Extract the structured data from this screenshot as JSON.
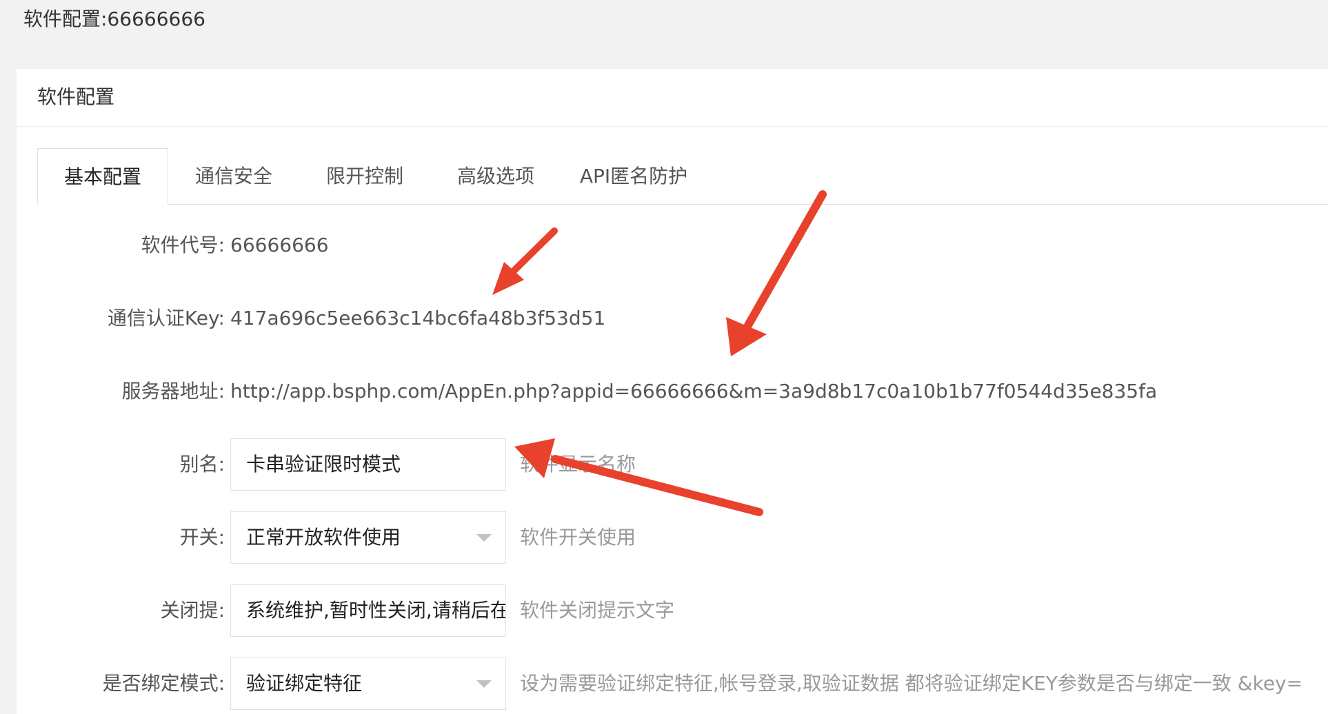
{
  "page": {
    "title": "软件配置:66666666"
  },
  "panel": {
    "title": "软件配置"
  },
  "tabs": [
    {
      "label": "基本配置",
      "active": true
    },
    {
      "label": "通信安全",
      "active": false
    },
    {
      "label": "限开控制",
      "active": false
    },
    {
      "label": "高级选项",
      "active": false
    },
    {
      "label": "API匿名防护",
      "active": false
    }
  ],
  "form": {
    "app_id": {
      "label": "软件代号:",
      "value": "66666666"
    },
    "auth_key": {
      "label": "通信认证Key:",
      "value": "417a696c5ee663c14bc6fa48b3f53d51"
    },
    "server_url": {
      "label": "服务器地址:",
      "value": "http://app.bsphp.com/AppEn.php?appid=66666666&m=3a9d8b17c0a10b1b77f0544d35e835fa"
    },
    "alias": {
      "label": "别名:",
      "value": "卡串验证限时模式",
      "help": "软件显示名称"
    },
    "switch": {
      "label": "开关:",
      "value": "正常开放软件使用",
      "help": "软件开关使用"
    },
    "close_notice": {
      "label": "关闭提:",
      "value": "系统维护,暂时性关闭,请稍后在",
      "help": "软件关闭提示文字"
    },
    "bind_mode": {
      "label": "是否绑定模式:",
      "value": "验证绑定特征",
      "help": "设为需要验证绑定特征,帐号登录,取验证数据 都将验证绑定KEY参数是否与绑定一致 &key="
    }
  },
  "colors": {
    "arrow": "#e8412c",
    "help_text": "#999999",
    "label_text": "#555555"
  }
}
